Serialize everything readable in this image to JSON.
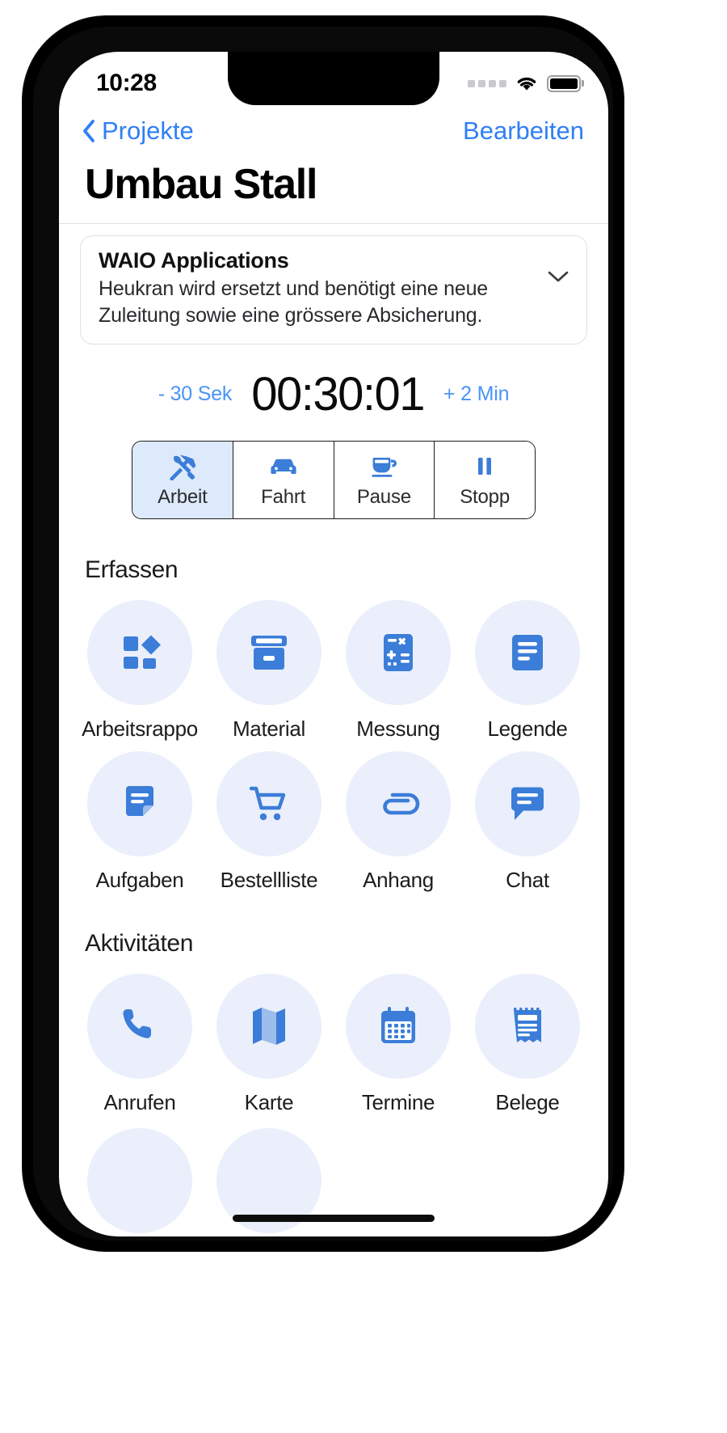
{
  "status_bar": {
    "time": "10:28",
    "cellular_icon": "cellular-dots-icon",
    "wifi_icon": "wifi-icon",
    "battery_icon": "battery-full-icon"
  },
  "nav": {
    "back_label": "Projekte",
    "back_icon": "chevron-left-icon",
    "edit_label": "Bearbeiten"
  },
  "page_title": "Umbau Stall",
  "description_card": {
    "title": "WAIO Applications",
    "body": "Heukran wird ersetzt und benötigt eine neue Zuleitung sowie eine grössere Absicherung.",
    "expand_icon": "chevron-down-icon"
  },
  "timer": {
    "decrement_label": "- 30 Sek",
    "value": "00:30:01",
    "increment_label": "+ 2 Min"
  },
  "segmented_control": {
    "selected_index": 0,
    "segments": [
      {
        "label": "Arbeit",
        "icon": "hammer-wrench-icon"
      },
      {
        "label": "Fahrt",
        "icon": "car-icon"
      },
      {
        "label": "Pause",
        "icon": "coffee-cup-icon"
      },
      {
        "label": "Stopp",
        "icon": "pause-icon"
      }
    ]
  },
  "sections": [
    {
      "title": "Erfassen",
      "tiles": [
        {
          "label": "Arbeitsrappo",
          "icon": "shapes-report-icon"
        },
        {
          "label": "Material",
          "icon": "archive-box-icon"
        },
        {
          "label": "Messung",
          "icon": "calculator-icon"
        },
        {
          "label": "Legende",
          "icon": "document-lines-icon"
        },
        {
          "label": "Aufgaben",
          "icon": "note-edit-icon"
        },
        {
          "label": "Bestellliste",
          "icon": "shopping-cart-icon"
        },
        {
          "label": "Anhang",
          "icon": "paperclip-icon"
        },
        {
          "label": "Chat",
          "icon": "chat-bubble-icon"
        }
      ]
    },
    {
      "title": "Aktivitäten",
      "tiles": [
        {
          "label": "Anrufen",
          "icon": "phone-icon"
        },
        {
          "label": "Karte",
          "icon": "map-icon"
        },
        {
          "label": "Termine",
          "icon": "calendar-icon"
        },
        {
          "label": "Belege",
          "icon": "receipt-icon"
        }
      ]
    }
  ],
  "colors": {
    "accent_blue": "#2f7ff5",
    "icon_blue": "#3b7dd8",
    "tile_bg": "#eaeffb",
    "selected_segment_bg": "#ddeafb"
  },
  "home_indicator": "home-indicator"
}
